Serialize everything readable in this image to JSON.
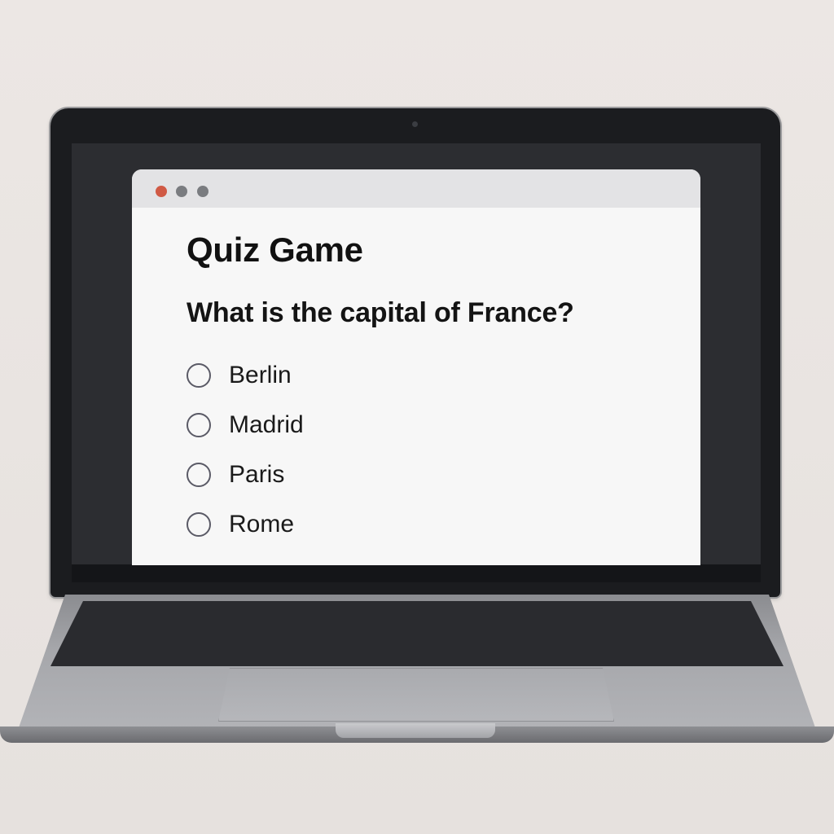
{
  "window": {
    "controls": [
      "close-dot",
      "minimize-dot",
      "maximize-dot"
    ]
  },
  "quiz": {
    "title": "Quiz Game",
    "question": "What is the capital of France?",
    "options": [
      "Berlin",
      "Madrid",
      "Paris",
      "Rome"
    ]
  },
  "colors": {
    "close_dot": "#d05a45",
    "inactive_dot": "#7a7c80",
    "screen_bg": "#2c2d31",
    "window_bg": "#f7f7f7"
  }
}
